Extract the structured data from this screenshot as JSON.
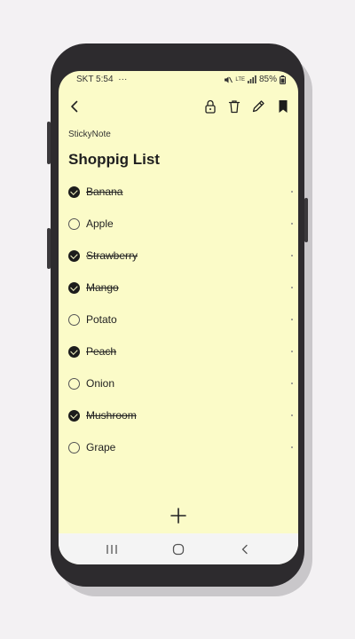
{
  "status_bar": {
    "carrier_time": "SKT 5:54",
    "more_glyph": "···",
    "network": "LTE",
    "battery": "85%"
  },
  "toolbar": {
    "back_icon": "chevron-left-icon",
    "lock_icon": "lock-icon",
    "delete_icon": "trash-icon",
    "edit_icon": "pencil-icon",
    "bookmark_icon": "bookmark-icon"
  },
  "note": {
    "app_name": "StickyNote",
    "title": "Shoppig List",
    "items": [
      {
        "label": "Banana",
        "checked": true
      },
      {
        "label": "Apple",
        "checked": false
      },
      {
        "label": "Strawberry",
        "checked": true
      },
      {
        "label": "Mango",
        "checked": true
      },
      {
        "label": "Potato",
        "checked": false
      },
      {
        "label": "Peach",
        "checked": true
      },
      {
        "label": "Onion",
        "checked": false
      },
      {
        "label": "Mushroom",
        "checked": true
      },
      {
        "label": "Grape",
        "checked": false
      }
    ]
  },
  "add_icon": "plus-icon",
  "nav_bar": {
    "recents_icon": "recents-icon",
    "home_icon": "home-icon",
    "back_icon": "back-icon"
  },
  "colors": {
    "note_background": "#fbfbc8",
    "device_frame": "#2d2b2e",
    "page_background": "#f3f1f3"
  }
}
